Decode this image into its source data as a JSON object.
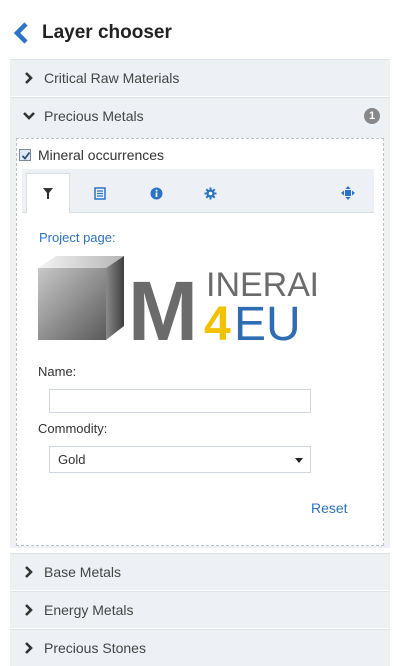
{
  "header": {
    "title": "Layer chooser",
    "back_icon": "chevron-left-icon"
  },
  "accordion": [
    {
      "label": "Critical Raw Materials",
      "expanded": false
    },
    {
      "label": "Precious Metals",
      "expanded": true,
      "badge": "1"
    },
    {
      "label": "Base Metals",
      "expanded": false
    },
    {
      "label": "Energy Metals",
      "expanded": false
    },
    {
      "label": "Precious Stones",
      "expanded": false
    }
  ],
  "layer": {
    "checkbox_label": "Mineral occurrences",
    "checked": true,
    "tabs": [
      {
        "icon": "filter-icon",
        "active": true
      },
      {
        "icon": "list-icon",
        "active": false
      },
      {
        "icon": "info-icon",
        "active": false
      },
      {
        "icon": "gear-icon",
        "active": false
      },
      {
        "icon": "move-icon",
        "active": false
      }
    ],
    "project_link": "Project page:",
    "logo_text": {
      "m": "M",
      "inerals": "INERALS",
      "four": "4",
      "eu": "EU"
    },
    "name_label": "Name:",
    "name_value": "",
    "commodity_label": "Commodity:",
    "commodity_value": "Gold",
    "reset_label": "Reset"
  },
  "colors": {
    "accent": "#2a73c9",
    "row_bg": "#edf1f5",
    "logo_gray": "#6b6b6b",
    "logo_yellow": "#f2c200",
    "logo_blue": "#2e6db4"
  }
}
